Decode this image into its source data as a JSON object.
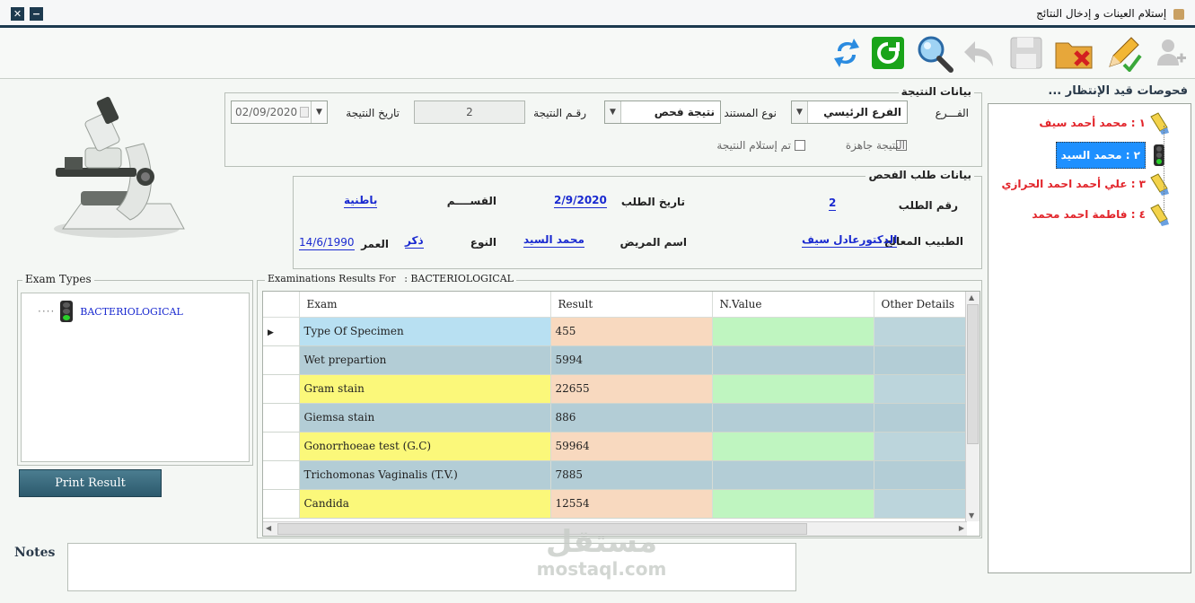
{
  "window": {
    "title": "إستلام العينات و إدخال النتائج"
  },
  "toolbar": {
    "icons": [
      "add-user-icon",
      "edit-pencil-icon",
      "delete-folder-icon",
      "save-icon",
      "undo-icon",
      "search-icon",
      "refresh-icon",
      "sync-icon"
    ]
  },
  "result_info": {
    "title": "بيانات النتيجة",
    "branch_label": "الفـــرع",
    "branch_value": "الفرع الرئيسي",
    "doc_type_label": "نوع المستند",
    "doc_type_value": "نتيجة فحص",
    "result_no_label": "رقـم النتيجة",
    "result_no_value": "2",
    "result_date_label": "تاريخ النتيجة",
    "result_date_value": "02/09/2020",
    "ready_label": "النتيجة جاهزة",
    "received_label": "تم إستلام النتيجة"
  },
  "request_info": {
    "title": "بيانات طلب الفحص",
    "request_no_label": "رقم الطلب",
    "request_no_value": "2",
    "request_date_label": "تاريخ الطلب",
    "request_date_value": "2/9/2020",
    "department_label": "القســــم",
    "department_value": "باطنية",
    "doctor_label": "الطبيب المعالج",
    "doctor_value": "الدكتورعادل سيف",
    "patient_label": "اسم المريض",
    "patient_value": "محمد السيد",
    "gender_label": "النوع",
    "gender_value": "ذكر",
    "age_label": "العمر",
    "age_value": "14/6/1990"
  },
  "exam_types": {
    "title": "Exam Types",
    "items": [
      "BACTERIOLOGICAL"
    ]
  },
  "print_button": "Print Result",
  "results": {
    "title": "Examinations Results For",
    "exam_name": ": BACTERIOLOGICAL",
    "columns": [
      "Exam",
      "Result",
      "N.Value",
      "Other Details"
    ],
    "rows": [
      {
        "exam": "Type Of Specimen",
        "result": "455",
        "exam_color": "#b8e0f2",
        "result_color": "#f8d9bf",
        "nv_color": "#bff5c0",
        "od_color": "#bcd5dc"
      },
      {
        "exam": "Wet prepartion",
        "result": "5994",
        "exam_color": "#b3cdd6",
        "result_color": "#b3cdd6",
        "nv_color": "#b3cdd6",
        "od_color": "#b3cdd6"
      },
      {
        "exam": "Gram stain",
        "result": "22655",
        "exam_color": "#fbf87a",
        "result_color": "#f8d9bf",
        "nv_color": "#bff5c0",
        "od_color": "#bcd5dc"
      },
      {
        "exam": "Giemsa stain",
        "result": "886",
        "exam_color": "#b3cdd6",
        "result_color": "#b3cdd6",
        "nv_color": "#b3cdd6",
        "od_color": "#b3cdd6"
      },
      {
        "exam": "Gonorrhoeae test (G.C)",
        "result": "59964",
        "exam_color": "#fbf87a",
        "result_color": "#f8d9bf",
        "nv_color": "#bff5c0",
        "od_color": "#bcd5dc"
      },
      {
        "exam": "Trichomonas Vaginalis (T.V.)",
        "result": "7885",
        "exam_color": "#b3cdd6",
        "result_color": "#b3cdd6",
        "nv_color": "#b3cdd6",
        "od_color": "#b3cdd6"
      },
      {
        "exam": "Candida",
        "result": "12554",
        "exam_color": "#fbf87a",
        "result_color": "#f8d9bf",
        "nv_color": "#bff5c0",
        "od_color": "#bcd5dc"
      }
    ]
  },
  "notes": {
    "label": "Notes",
    "value": ""
  },
  "queue": {
    "title": "فحوصات قيد الإنتظار ...",
    "items": [
      {
        "label": "١ : محمد أحمد سيف",
        "selected": false,
        "icon": "broom-icon"
      },
      {
        "label": "٢ : محمد السيد",
        "selected": true,
        "icon": "traffic-light-icon"
      },
      {
        "label": "٣ : علي أحمد احمد الحرازي",
        "selected": false,
        "icon": "broom-icon"
      },
      {
        "label": "٤ : فاطمة احمد محمد",
        "selected": false,
        "icon": "broom-icon"
      }
    ]
  },
  "watermark": {
    "arabic": "مستقل",
    "latin": "mostaql.com"
  },
  "colors": {
    "title_bar": "#1d3a4f",
    "link_blue": "#1a2ad0",
    "queue_red": "#e2242a",
    "selected": "#1e90ff"
  }
}
